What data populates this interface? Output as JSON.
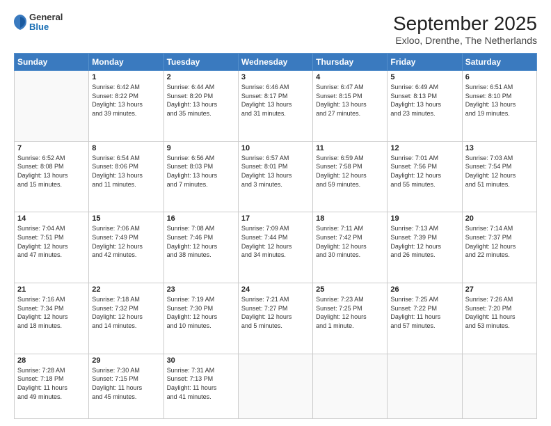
{
  "logo": {
    "general": "General",
    "blue": "Blue"
  },
  "title": "September 2025",
  "subtitle": "Exloo, Drenthe, The Netherlands",
  "days_of_week": [
    "Sunday",
    "Monday",
    "Tuesday",
    "Wednesday",
    "Thursday",
    "Friday",
    "Saturday"
  ],
  "weeks": [
    [
      {
        "day": "",
        "info": ""
      },
      {
        "day": "1",
        "info": "Sunrise: 6:42 AM\nSunset: 8:22 PM\nDaylight: 13 hours\nand 39 minutes."
      },
      {
        "day": "2",
        "info": "Sunrise: 6:44 AM\nSunset: 8:20 PM\nDaylight: 13 hours\nand 35 minutes."
      },
      {
        "day": "3",
        "info": "Sunrise: 6:46 AM\nSunset: 8:17 PM\nDaylight: 13 hours\nand 31 minutes."
      },
      {
        "day": "4",
        "info": "Sunrise: 6:47 AM\nSunset: 8:15 PM\nDaylight: 13 hours\nand 27 minutes."
      },
      {
        "day": "5",
        "info": "Sunrise: 6:49 AM\nSunset: 8:13 PM\nDaylight: 13 hours\nand 23 minutes."
      },
      {
        "day": "6",
        "info": "Sunrise: 6:51 AM\nSunset: 8:10 PM\nDaylight: 13 hours\nand 19 minutes."
      }
    ],
    [
      {
        "day": "7",
        "info": "Sunrise: 6:52 AM\nSunset: 8:08 PM\nDaylight: 13 hours\nand 15 minutes."
      },
      {
        "day": "8",
        "info": "Sunrise: 6:54 AM\nSunset: 8:06 PM\nDaylight: 13 hours\nand 11 minutes."
      },
      {
        "day": "9",
        "info": "Sunrise: 6:56 AM\nSunset: 8:03 PM\nDaylight: 13 hours\nand 7 minutes."
      },
      {
        "day": "10",
        "info": "Sunrise: 6:57 AM\nSunset: 8:01 PM\nDaylight: 13 hours\nand 3 minutes."
      },
      {
        "day": "11",
        "info": "Sunrise: 6:59 AM\nSunset: 7:58 PM\nDaylight: 12 hours\nand 59 minutes."
      },
      {
        "day": "12",
        "info": "Sunrise: 7:01 AM\nSunset: 7:56 PM\nDaylight: 12 hours\nand 55 minutes."
      },
      {
        "day": "13",
        "info": "Sunrise: 7:03 AM\nSunset: 7:54 PM\nDaylight: 12 hours\nand 51 minutes."
      }
    ],
    [
      {
        "day": "14",
        "info": "Sunrise: 7:04 AM\nSunset: 7:51 PM\nDaylight: 12 hours\nand 47 minutes."
      },
      {
        "day": "15",
        "info": "Sunrise: 7:06 AM\nSunset: 7:49 PM\nDaylight: 12 hours\nand 42 minutes."
      },
      {
        "day": "16",
        "info": "Sunrise: 7:08 AM\nSunset: 7:46 PM\nDaylight: 12 hours\nand 38 minutes."
      },
      {
        "day": "17",
        "info": "Sunrise: 7:09 AM\nSunset: 7:44 PM\nDaylight: 12 hours\nand 34 minutes."
      },
      {
        "day": "18",
        "info": "Sunrise: 7:11 AM\nSunset: 7:42 PM\nDaylight: 12 hours\nand 30 minutes."
      },
      {
        "day": "19",
        "info": "Sunrise: 7:13 AM\nSunset: 7:39 PM\nDaylight: 12 hours\nand 26 minutes."
      },
      {
        "day": "20",
        "info": "Sunrise: 7:14 AM\nSunset: 7:37 PM\nDaylight: 12 hours\nand 22 minutes."
      }
    ],
    [
      {
        "day": "21",
        "info": "Sunrise: 7:16 AM\nSunset: 7:34 PM\nDaylight: 12 hours\nand 18 minutes."
      },
      {
        "day": "22",
        "info": "Sunrise: 7:18 AM\nSunset: 7:32 PM\nDaylight: 12 hours\nand 14 minutes."
      },
      {
        "day": "23",
        "info": "Sunrise: 7:19 AM\nSunset: 7:30 PM\nDaylight: 12 hours\nand 10 minutes."
      },
      {
        "day": "24",
        "info": "Sunrise: 7:21 AM\nSunset: 7:27 PM\nDaylight: 12 hours\nand 5 minutes."
      },
      {
        "day": "25",
        "info": "Sunrise: 7:23 AM\nSunset: 7:25 PM\nDaylight: 12 hours\nand 1 minute."
      },
      {
        "day": "26",
        "info": "Sunrise: 7:25 AM\nSunset: 7:22 PM\nDaylight: 11 hours\nand 57 minutes."
      },
      {
        "day": "27",
        "info": "Sunrise: 7:26 AM\nSunset: 7:20 PM\nDaylight: 11 hours\nand 53 minutes."
      }
    ],
    [
      {
        "day": "28",
        "info": "Sunrise: 7:28 AM\nSunset: 7:18 PM\nDaylight: 11 hours\nand 49 minutes."
      },
      {
        "day": "29",
        "info": "Sunrise: 7:30 AM\nSunset: 7:15 PM\nDaylight: 11 hours\nand 45 minutes."
      },
      {
        "day": "30",
        "info": "Sunrise: 7:31 AM\nSunset: 7:13 PM\nDaylight: 11 hours\nand 41 minutes."
      },
      {
        "day": "",
        "info": ""
      },
      {
        "day": "",
        "info": ""
      },
      {
        "day": "",
        "info": ""
      },
      {
        "day": "",
        "info": ""
      }
    ]
  ]
}
